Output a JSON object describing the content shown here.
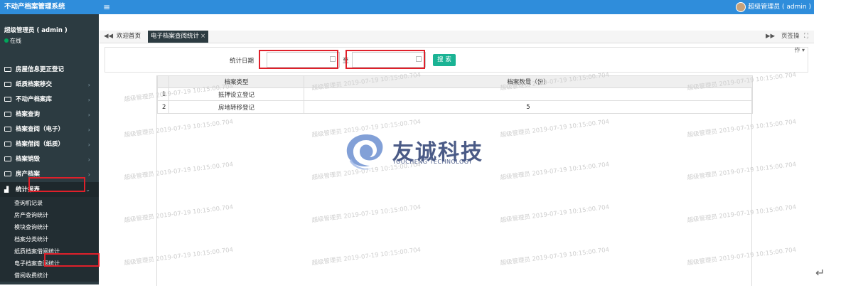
{
  "app": {
    "title": "不动产档案管理系统",
    "user_label": "超级管理员 ( admin )"
  },
  "sidebar": {
    "user_name": "超级管理员 ( admin )",
    "status": "在线",
    "menu": [
      {
        "label": "房屋信息更正登记",
        "has_children": false
      },
      {
        "label": "纸质档案移交",
        "has_children": true
      },
      {
        "label": "不动产档案库",
        "has_children": true
      },
      {
        "label": "档案查询",
        "has_children": true
      },
      {
        "label": "档案查阅（电子）",
        "has_children": true
      },
      {
        "label": "档案借阅（纸质）",
        "has_children": true
      },
      {
        "label": "档案销毁",
        "has_children": true
      },
      {
        "label": "房产档案",
        "has_children": true
      }
    ],
    "active_menu": {
      "label": "统计报表",
      "caret": "⌄"
    },
    "submenu": [
      {
        "label": "查询机记录"
      },
      {
        "label": "房产查询统计"
      },
      {
        "label": "模块查询统计"
      },
      {
        "label": "档案分类统计"
      },
      {
        "label": "纸质档案借阅统计"
      },
      {
        "label": "电子档案查阅统计"
      },
      {
        "label": "借阅收费统计"
      }
    ]
  },
  "tabs": {
    "back": "◀◀",
    "home": "欢迎首页",
    "active": "电子档案查阅统计",
    "close": "×",
    "forward": "▶▶",
    "page_ops": "页签操",
    "fullscreen": "⛶"
  },
  "filter": {
    "ops_label": "作",
    "date_label": "统计日期",
    "to_label": "至",
    "start_value": "",
    "end_value": "",
    "search_label": "搜 索"
  },
  "table": {
    "columns": [
      "档案类型",
      "档案数量（份）"
    ],
    "rows": [
      {
        "n": "1",
        "type": "抵押设立登记",
        "count": ""
      },
      {
        "n": "2",
        "type": "房地转移登记",
        "count": "5"
      }
    ]
  },
  "watermark": {
    "text": "超级管理员 2019-07-19 10:15:00.704"
  },
  "logo": {
    "name": "友诚科技",
    "subtitle": "YOUCHENG TECHNOLOGY"
  },
  "colors": {
    "topbar": "#2f8ddb",
    "sidebar": "#2c3b41",
    "search_button": "#1ab394",
    "highlight": "#e0202a"
  }
}
